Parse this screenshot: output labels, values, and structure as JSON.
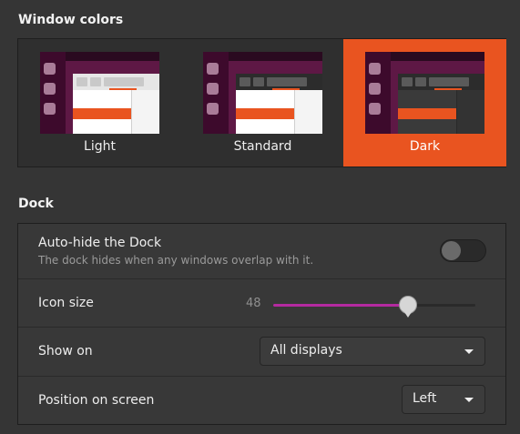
{
  "window_colors": {
    "title": "Window colors",
    "options": [
      {
        "label": "Light",
        "selected": false
      },
      {
        "label": "Standard",
        "selected": false
      },
      {
        "label": "Dark",
        "selected": true
      }
    ]
  },
  "dock": {
    "title": "Dock",
    "auto_hide": {
      "label": "Auto-hide the Dock",
      "description": "The dock hides when any windows overlap with it.",
      "enabled": false
    },
    "icon_size": {
      "label": "Icon size",
      "value": "48",
      "min": 16,
      "max": 64
    },
    "show_on": {
      "label": "Show on",
      "value": "All displays"
    },
    "position": {
      "label": "Position on screen",
      "value": "Left"
    }
  },
  "colors": {
    "accent": "#e95420",
    "slider_fill": "#b42aa0",
    "background": "#353535"
  }
}
